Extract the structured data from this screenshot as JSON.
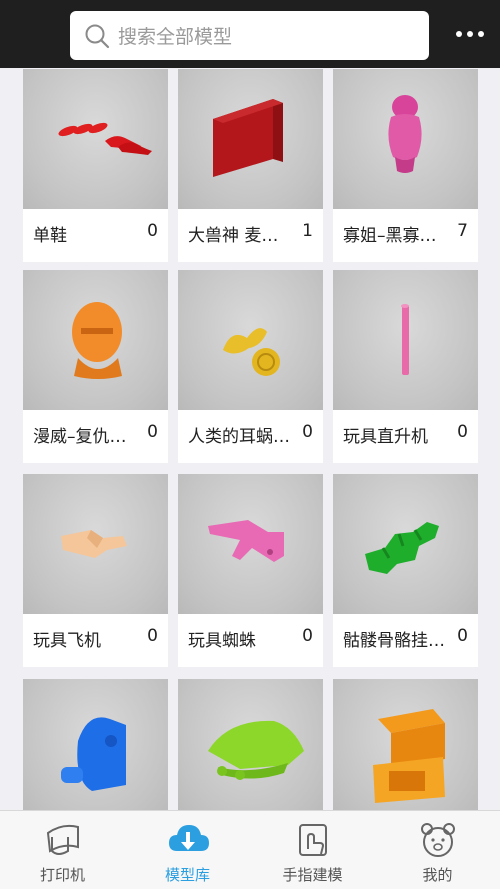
{
  "search": {
    "placeholder": "搜索全部模型"
  },
  "models": [
    {
      "name": "单鞋",
      "count": "0"
    },
    {
      "name": "大兽神 麦…",
      "count": "1"
    },
    {
      "name": "寡姐–黑寡…",
      "count": "7"
    },
    {
      "name": "漫威–复仇…",
      "count": "0"
    },
    {
      "name": "人类的耳蜗…",
      "count": "0"
    },
    {
      "name": "玩具直升机",
      "count": "0"
    },
    {
      "name": "玩具飞机",
      "count": "0"
    },
    {
      "name": "玩具蜘蛛",
      "count": "0"
    },
    {
      "name": "骷髅骨骼挂…",
      "count": "0"
    },
    {
      "name": "",
      "count": ""
    },
    {
      "name": "",
      "count": ""
    },
    {
      "name": "",
      "count": ""
    }
  ],
  "tabs": [
    {
      "label": "打印机",
      "icon": "printer-icon"
    },
    {
      "label": "模型库",
      "icon": "cloud-download-icon"
    },
    {
      "label": "手指建模",
      "icon": "finger-model-icon"
    },
    {
      "label": "我的",
      "icon": "bear-profile-icon"
    }
  ],
  "colors": {
    "accent": "#2c9fe0",
    "topbar": "#1f1f1f"
  }
}
